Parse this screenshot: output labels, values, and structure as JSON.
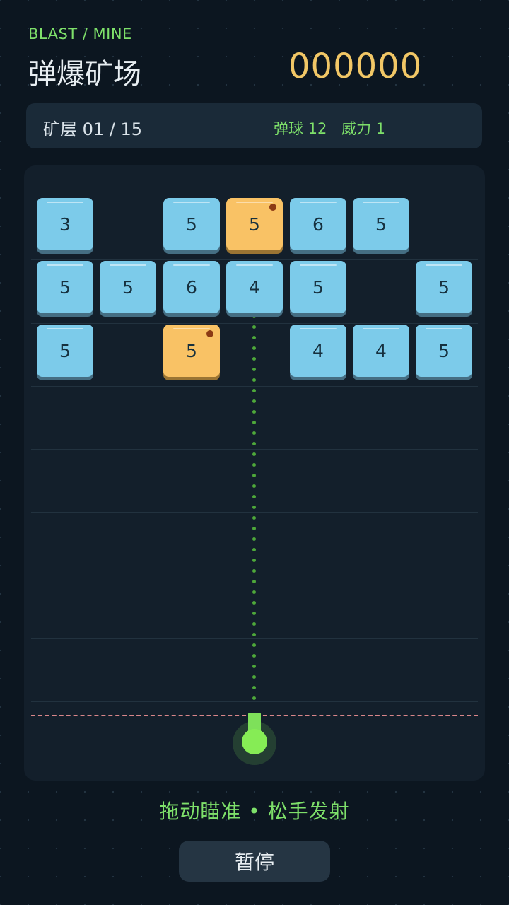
{
  "header": {
    "subtitle": "BLAST / MINE",
    "title": "弹爆矿场",
    "score": "000000"
  },
  "status": {
    "level": "矿层 01 / 15",
    "balls": "弹球 12",
    "power": "威力 1"
  },
  "board": {
    "columns": 7,
    "rows": 3,
    "blocks": [
      [
        {
          "value": "3",
          "type": "normal"
        },
        null,
        {
          "value": "5",
          "type": "normal"
        },
        {
          "value": "5",
          "type": "bomb"
        },
        {
          "value": "6",
          "type": "normal"
        },
        {
          "value": "5",
          "type": "normal"
        },
        null
      ],
      [
        {
          "value": "5",
          "type": "normal"
        },
        {
          "value": "5",
          "type": "normal"
        },
        {
          "value": "6",
          "type": "normal"
        },
        {
          "value": "4",
          "type": "normal"
        },
        {
          "value": "5",
          "type": "normal"
        },
        null,
        {
          "value": "5",
          "type": "normal"
        }
      ],
      [
        {
          "value": "5",
          "type": "normal"
        },
        null,
        {
          "value": "5",
          "type": "bomb"
        },
        null,
        {
          "value": "4",
          "type": "normal"
        },
        {
          "value": "4",
          "type": "normal"
        },
        {
          "value": "5",
          "type": "normal"
        }
      ]
    ]
  },
  "hint": "拖动瞄准 • 松手发射",
  "pause_button": "暂停",
  "colors": {
    "background": "#0c1620",
    "accent_green": "#7ee06a",
    "score_gold": "#f2c766",
    "block_blue": "#7ccbea",
    "block_gold": "#f9c265",
    "danger_line": "#d9868a"
  },
  "icons": {
    "bomb": "bomb-dot-icon",
    "launcher": "launcher-icon"
  }
}
